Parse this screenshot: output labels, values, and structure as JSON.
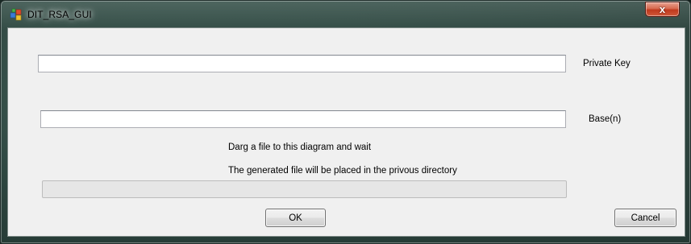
{
  "window": {
    "title": "DIT_RSA_GUI",
    "close_glyph": "x"
  },
  "form": {
    "private_key": {
      "label": "Private Key",
      "value": "",
      "placeholder": ""
    },
    "base": {
      "label": "Base(n)",
      "value": "",
      "placeholder": ""
    },
    "instruction_drag": "Darg a file to this diagram and wait",
    "instruction_output": "The generated file will be placed in the privous directory",
    "progress_percent": 0
  },
  "buttons": {
    "ok_label": "OK",
    "cancel_label": "Cancel"
  },
  "icons": {
    "app": "app-window-icon",
    "close": "close-icon"
  }
}
